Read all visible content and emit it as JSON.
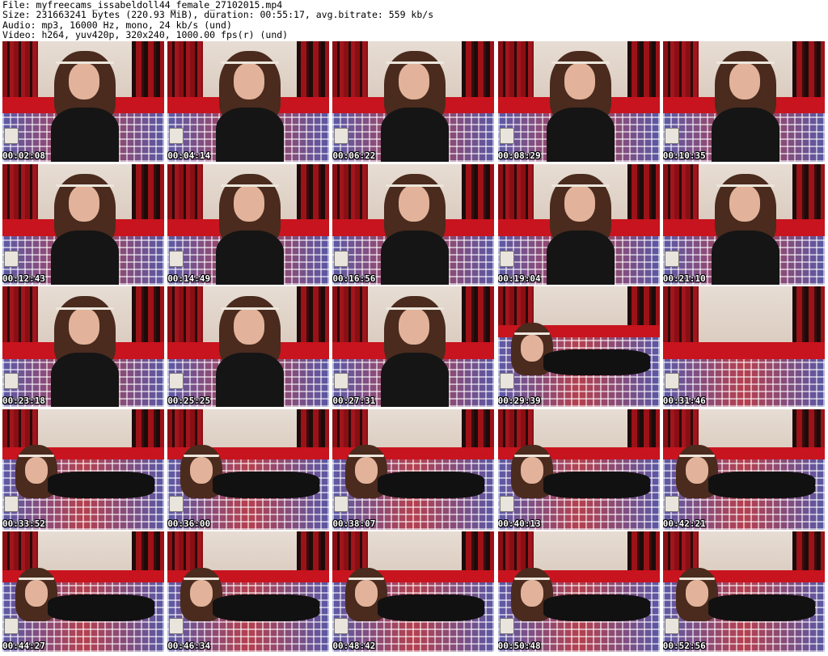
{
  "header": {
    "file": "File: myfreecams_issabeldoll44_female_27102015.mp4",
    "size": "Size: 231663241 bytes (220.93 MiB), duration: 00:55:17, avg.bitrate: 559 kb/s",
    "audio": "Audio: mp3, 16000 Hz, mono, 24 kb/s (und)",
    "video": "Video: h264, yuv420p, 320x240, 1000.00 fps(r) (und)"
  },
  "thumbnails": [
    {
      "time": "00:02:08",
      "scene": "sitting"
    },
    {
      "time": "00:04:14",
      "scene": "sitting"
    },
    {
      "time": "00:06:22",
      "scene": "sitting"
    },
    {
      "time": "00:08:29",
      "scene": "sitting"
    },
    {
      "time": "00:10:35",
      "scene": "sitting"
    },
    {
      "time": "00:12:43",
      "scene": "sitting"
    },
    {
      "time": "00:14:49",
      "scene": "sitting"
    },
    {
      "time": "00:16:56",
      "scene": "sitting"
    },
    {
      "time": "00:19:04",
      "scene": "sitting"
    },
    {
      "time": "00:21:10",
      "scene": "sitting"
    },
    {
      "time": "00:23:18",
      "scene": "sitting"
    },
    {
      "time": "00:25:25",
      "scene": "sitting"
    },
    {
      "time": "00:27:31",
      "scene": "sitting"
    },
    {
      "time": "00:29:39",
      "scene": "lying"
    },
    {
      "time": "00:31:46",
      "scene": "empty"
    },
    {
      "time": "00:33:52",
      "scene": "lying"
    },
    {
      "time": "00:36:00",
      "scene": "lying"
    },
    {
      "time": "00:38:07",
      "scene": "lying"
    },
    {
      "time": "00:40:13",
      "scene": "lying"
    },
    {
      "time": "00:42:21",
      "scene": "lying"
    },
    {
      "time": "00:44:27",
      "scene": "lying"
    },
    {
      "time": "00:46:34",
      "scene": "lying"
    },
    {
      "time": "00:48:42",
      "scene": "lying"
    },
    {
      "time": "00:50:48",
      "scene": "lying"
    },
    {
      "time": "00:52:56",
      "scene": "lying"
    }
  ]
}
